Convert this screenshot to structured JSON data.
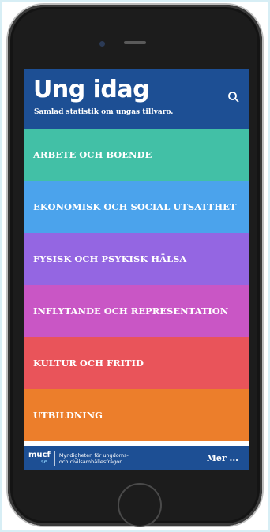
{
  "header": {
    "title": "Ung idag",
    "subtitle": "Samlad statistik om ungas tillvaro.",
    "search_icon": "search-icon"
  },
  "menu": {
    "items": [
      {
        "label": "ARBETE OCH BOENDE",
        "color": "#42c0a6"
      },
      {
        "label": "EKONOMISK OCH SOCIAL UTSATTHET",
        "color": "#4ba3ec"
      },
      {
        "label": "FYSISK OCH PSYKISK HÄLSA",
        "color": "#9466e2"
      },
      {
        "label": "INFLYTANDE OCH REPRESENTATION",
        "color": "#c956c5"
      },
      {
        "label": "KULTUR OCH FRITID",
        "color": "#e9545a"
      },
      {
        "label": "UTBILDNING",
        "color": "#ec7e2b"
      }
    ]
  },
  "footer": {
    "logo_text": "mucf",
    "logo_suffix": "se",
    "agency_line1": "Myndigheten för ungdoms-",
    "agency_line2": "och civilsamhällesfrågor",
    "more_label": "Mer ..."
  },
  "colors": {
    "header_bg": "#1d4f94",
    "page_bg": "#d7eef5"
  }
}
